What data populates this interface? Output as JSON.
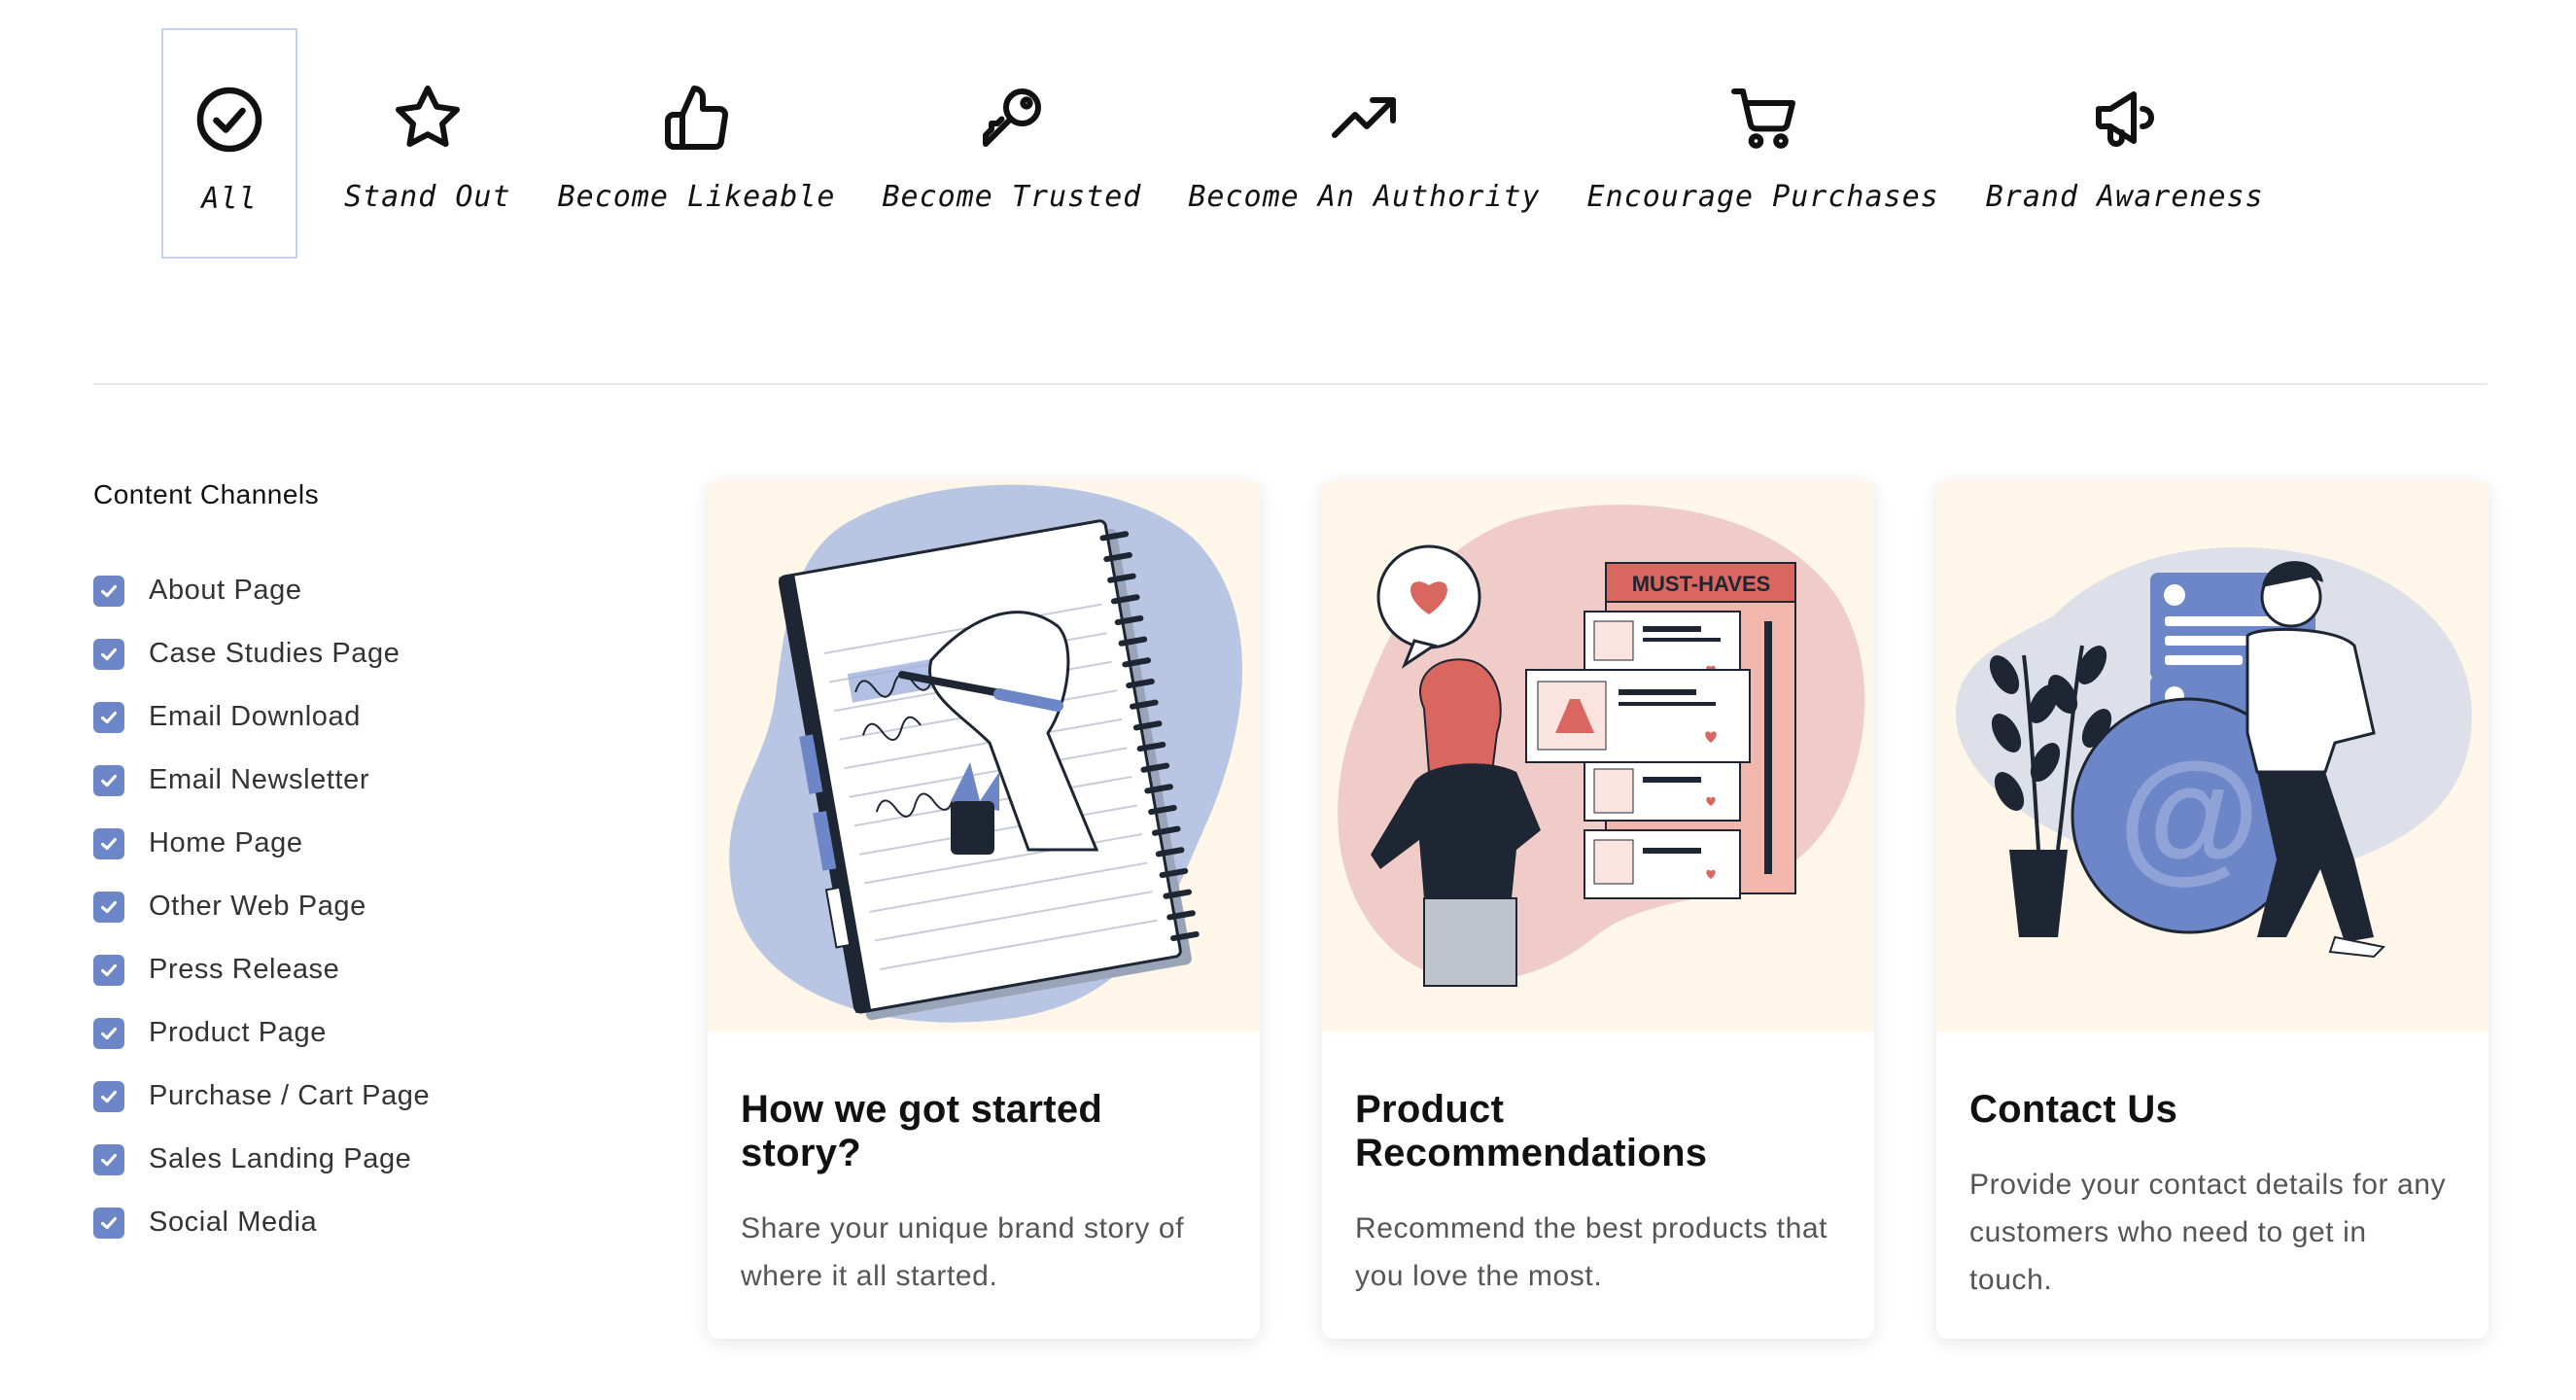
{
  "filters": [
    {
      "label": "All",
      "icon": "check-circle-icon",
      "active": true
    },
    {
      "label": "Stand Out",
      "icon": "star-icon",
      "active": false
    },
    {
      "label": "Become Likeable",
      "icon": "thumbs-up-icon",
      "active": false
    },
    {
      "label": "Become Trusted",
      "icon": "key-icon",
      "active": false
    },
    {
      "label": "Become An Authority",
      "icon": "trending-up-icon",
      "active": false
    },
    {
      "label": "Encourage Purchases",
      "icon": "cart-icon",
      "active": false
    },
    {
      "label": "Brand Awareness",
      "icon": "megaphone-icon",
      "active": false
    }
  ],
  "sidebar": {
    "title": "Content Channels",
    "items": [
      {
        "label": "About Page",
        "checked": true
      },
      {
        "label": "Case Studies Page",
        "checked": true
      },
      {
        "label": "Email Download",
        "checked": true
      },
      {
        "label": "Email Newsletter",
        "checked": true
      },
      {
        "label": "Home Page",
        "checked": true
      },
      {
        "label": "Other Web Page",
        "checked": true
      },
      {
        "label": "Press Release",
        "checked": true
      },
      {
        "label": "Product Page",
        "checked": true
      },
      {
        "label": "Purchase / Cart Page",
        "checked": true
      },
      {
        "label": "Sales Landing Page",
        "checked": true
      },
      {
        "label": "Social Media",
        "checked": true
      }
    ]
  },
  "cards": [
    {
      "title": "How we got started story?",
      "description": "Share your unique brand story of where it all started.",
      "illustration": "notebook-writing-illustration"
    },
    {
      "title": "Product Recommendations",
      "description": "Recommend the best products that you love the most.",
      "illustration": "shopping-wishlist-illustration",
      "banner_text": "MUST-HAVES"
    },
    {
      "title": "Contact Us",
      "description": "Provide your contact details for any customers who need to get in touch.",
      "illustration": "contact-email-illustration",
      "at_symbol": "@"
    }
  ],
  "colors": {
    "accent": "#6c86c8",
    "card_image_bg": "#fdf6e9",
    "active_tab_border": "#c4d4ee",
    "blob_blue": "#b9c6e3",
    "blob_pink": "#efccc7",
    "blob_gray": "#dde0e8"
  }
}
